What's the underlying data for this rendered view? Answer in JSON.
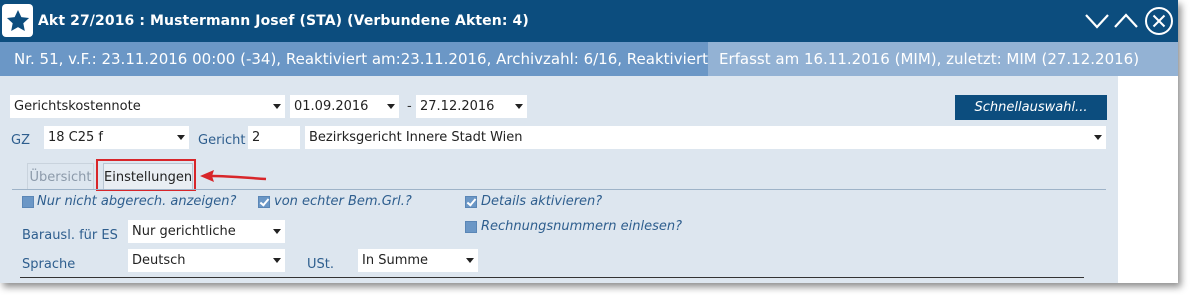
{
  "window": {
    "title": "Akt 27/2016 : Mustermann Josef (STA) (Verbundene Akten: 4)"
  },
  "infobar": {
    "left_text": "Nr. 51, v.F.: 23.11.2016 00:00 (-34), Reaktiviert am:23.11.2016, Archivzahl: 6/16, Reaktiviert von:",
    "right_text": "Erfasst am 16.11.2016 (MIM), zuletzt: MIM (27.12.2016)"
  },
  "filters": {
    "report_type": "Gerichtskostennote",
    "date_from": "01.09.2016",
    "date_separator": "-",
    "date_to": "27.12.2016",
    "quick_select_label": "Schnellauswahl..."
  },
  "gz": {
    "label": "GZ",
    "value": "18 C25 f",
    "court_label": "Gericht",
    "court_number": "2",
    "court_name": "Bezirksgericht Innere Stadt Wien"
  },
  "tabs": [
    {
      "label": "Übersicht",
      "active": false
    },
    {
      "label": "Einstellungen",
      "active": true
    }
  ],
  "settings": {
    "only_unbilled": {
      "label": "Nur nicht abgerech. anzeigen?",
      "checked": false
    },
    "real_basis": {
      "label": "von echter Bem.Grl.?",
      "checked": true
    },
    "activate_details": {
      "label": "Details aktivieren?",
      "checked": true
    },
    "read_invoice_numbers": {
      "label": "Rechnungsnummern einlesen?",
      "checked": false
    },
    "cash_expenses_label": "Barausl. für ES",
    "cash_expenses_value": "Nur gerichtliche",
    "language_label": "Sprache",
    "language_value": "Deutsch",
    "vat_label": "USt.",
    "vat_value": "In Summe"
  },
  "colors": {
    "titlebar": "#0c4d7e",
    "infobar": "#6b97c6",
    "content_bg": "#dde6ef",
    "highlight": "#d8262a"
  }
}
